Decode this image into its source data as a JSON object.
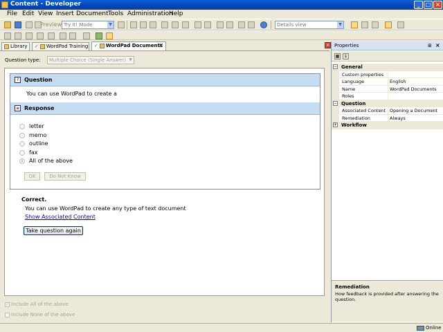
{
  "window": {
    "title": "Content - Developer"
  },
  "menu": [
    "File",
    "Edit",
    "View",
    "Insert",
    "Document",
    "Tools",
    "Administration",
    "Help"
  ],
  "toolbar": {
    "preview_label": "Preview",
    "mode_value": "Try It! Mode",
    "view_value": "Details view"
  },
  "tabs": [
    {
      "label": "Library"
    },
    {
      "label": "WordPad Training"
    },
    {
      "label": "WordPad Documents",
      "active": true
    }
  ],
  "question_type": {
    "label": "Question type:",
    "value": "Multiple Choice (Single Answer)"
  },
  "question": {
    "header": "Question",
    "text": "You can use WordPad to create a"
  },
  "response": {
    "header": "Response",
    "options": [
      {
        "label": "letter",
        "selected": false
      },
      {
        "label": "memo",
        "selected": false
      },
      {
        "label": "outline",
        "selected": false
      },
      {
        "label": "fax",
        "selected": false
      },
      {
        "label": "All of the above",
        "selected": true
      }
    ],
    "ok_label": "OK",
    "dont_know_label": "Do Not Know"
  },
  "feedback": {
    "title": "Correct.",
    "text": "You can use WordPad to create any type of text document",
    "link": "Show Associated Content",
    "retry_label": "Take question again"
  },
  "options": {
    "include_all": "Include All of the above",
    "include_none": "Include None of the above"
  },
  "properties": {
    "title": "Properties",
    "categories": [
      {
        "name": "General",
        "expanded": true,
        "rows": [
          {
            "key": "Custom properties",
            "value": ""
          },
          {
            "key": "Language",
            "value": "English"
          },
          {
            "key": "Name",
            "value": "WordPad Documents"
          },
          {
            "key": "Roles",
            "value": ""
          }
        ]
      },
      {
        "name": "Question",
        "expanded": true,
        "rows": [
          {
            "key": "Associated Content",
            "value": "Opening a Document"
          },
          {
            "key": "Remediation",
            "value": "Always"
          }
        ]
      },
      {
        "name": "Workflow",
        "expanded": false,
        "rows": []
      }
    ],
    "help_title": "Remediation",
    "help_text": "How feedback is provided after answering the question."
  },
  "status": {
    "text": "Online"
  }
}
